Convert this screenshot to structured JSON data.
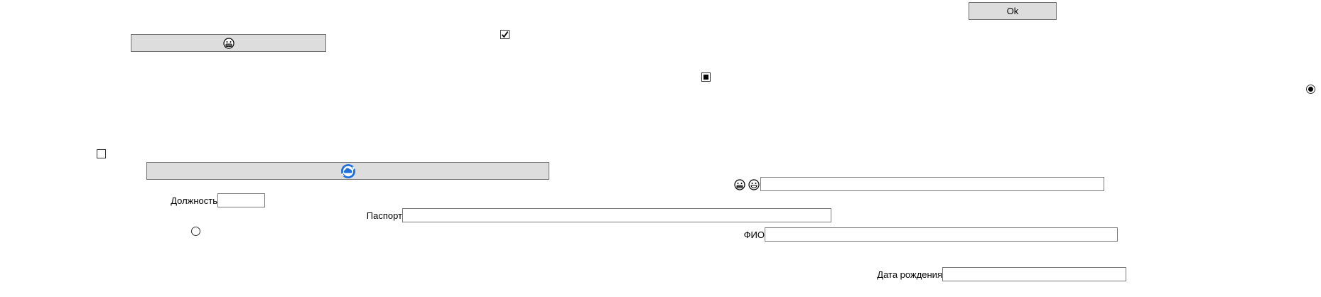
{
  "window": {
    "ok_button_label": "Ok"
  },
  "icons": {
    "emoji_grin": "😬",
    "emoji_smile": "😀",
    "cloud_sync": "cloud-sync-icon"
  },
  "form": {
    "position_label": "Должность",
    "position_value": "",
    "passport_label": "Паспорт",
    "passport_value": "",
    "fio_label": "ФИО",
    "fio_value": "",
    "top_text_value": "",
    "birthdate_label": "Дата рождения",
    "birthdate_value": ""
  },
  "states": {
    "checkbox_top_checked": true,
    "checkbox_mid_indeterminate": true,
    "checkbox_left_checked": false,
    "radio_right_selected": true,
    "radio_left_selected": false
  },
  "colors": {
    "button_bg": "#dddddd",
    "border": "#707070",
    "accent": "#1e6fd9"
  }
}
